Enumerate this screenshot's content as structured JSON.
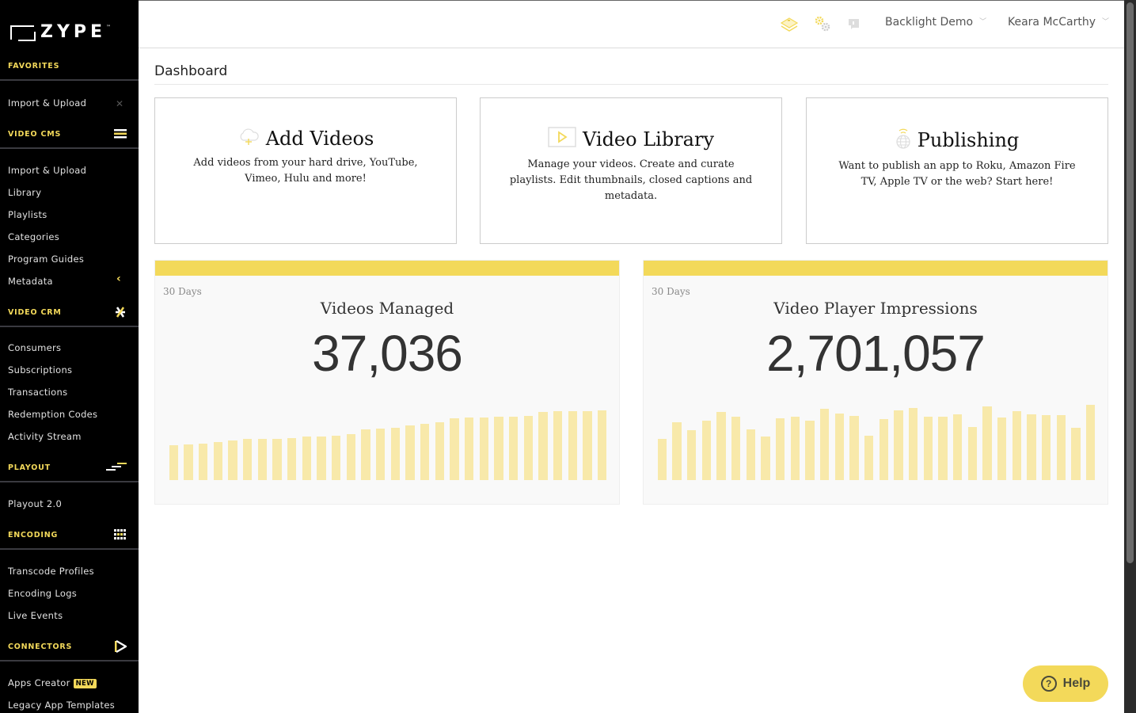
{
  "brand": {
    "name": "ZYPE",
    "tm": "™",
    "accent": "#f3d95a"
  },
  "sidebar": {
    "favorites": {
      "label": "FAVORITES",
      "items": [
        {
          "label": "Import & Upload",
          "remove_icon": "close-icon"
        }
      ]
    },
    "sections": [
      {
        "label": "VIDEO CMS",
        "icon": "stacked-bars-icon",
        "items": [
          "Import & Upload",
          "Library",
          "Playlists",
          "Categories",
          "Program Guides",
          "Metadata"
        ]
      },
      {
        "label": "VIDEO CRM",
        "icon": "asterisk-icon",
        "items": [
          "Consumers",
          "Subscriptions",
          "Transactions",
          "Redemption Codes",
          "Activity Stream"
        ]
      },
      {
        "label": "PLAYOUT",
        "icon": "stair-lines-icon",
        "items": [
          "Playout 2.0"
        ]
      },
      {
        "label": "ENCODING",
        "icon": "grid-dots-icon",
        "items": [
          "Transcode Profiles",
          "Encoding Logs",
          "Live Events"
        ]
      },
      {
        "label": "CONNECTORS",
        "icon": "play-triangle-icon",
        "items": [
          "Apps Creator",
          "Legacy App Templates"
        ]
      }
    ],
    "new_badge": "NEW"
  },
  "topbar": {
    "icons": [
      "layers-icon",
      "gears-icon",
      "flag-icon"
    ],
    "account": "Backlight Demo",
    "user": "Keara McCarthy",
    "chevron": "⌵"
  },
  "page": {
    "title": "Dashboard"
  },
  "cards": [
    {
      "title": "Add Videos",
      "icon": "cloud-upload-icon",
      "desc": "Add videos from your hard drive, YouTube, Vimeo, Hulu and more!"
    },
    {
      "title": "Video Library",
      "icon": "video-play-icon",
      "desc": "Manage your videos. Create and curate playlists. Edit thumbnails, closed captions and metadata."
    },
    {
      "title": "Publishing",
      "icon": "globe-signal-icon",
      "desc": "Want to publish an app to Roku, Amazon Fire TV, Apple TV or the web? Start here!"
    }
  ],
  "stats": [
    {
      "period": "30 Days",
      "label": "Videos Managed",
      "value": "37,036"
    },
    {
      "period": "30 Days",
      "label": "Video Player Impressions",
      "value": "2,701,057"
    }
  ],
  "chart_data": [
    {
      "type": "bar",
      "title": "Videos Managed",
      "xlabel": "",
      "ylabel": "",
      "categories": [
        "1",
        "2",
        "3",
        "4",
        "5",
        "6",
        "7",
        "8",
        "9",
        "10",
        "11",
        "12",
        "13",
        "14",
        "15",
        "16",
        "17",
        "18",
        "19",
        "20",
        "21",
        "22",
        "23",
        "24",
        "25",
        "26",
        "27",
        "28",
        "29",
        "30"
      ],
      "values": [
        44,
        45,
        46,
        48,
        50,
        52,
        52,
        52,
        53,
        55,
        55,
        56,
        58,
        64,
        65,
        66,
        69,
        71,
        73,
        78,
        79,
        79,
        80,
        80,
        81,
        86,
        87,
        87,
        87,
        88
      ],
      "ylim": [
        0,
        100
      ],
      "grid": false
    },
    {
      "type": "bar",
      "title": "Video Player Impressions",
      "xlabel": "",
      "ylabel": "",
      "categories": [
        "1",
        "2",
        "3",
        "4",
        "5",
        "6",
        "7",
        "8",
        "9",
        "10",
        "11",
        "12",
        "13",
        "14",
        "15",
        "16",
        "17",
        "18",
        "19",
        "20",
        "21",
        "22",
        "23",
        "24",
        "25",
        "26",
        "27",
        "28",
        "29",
        "30"
      ],
      "values": [
        52,
        73,
        63,
        75,
        86,
        80,
        64,
        55,
        78,
        80,
        75,
        90,
        84,
        81,
        56,
        77,
        88,
        91,
        80,
        80,
        83,
        67,
        93,
        79,
        87,
        83,
        82,
        82,
        66,
        95
      ],
      "ylim": [
        0,
        100
      ],
      "grid": false
    }
  ],
  "help": {
    "label": "Help",
    "icon": "question-circle-icon"
  }
}
